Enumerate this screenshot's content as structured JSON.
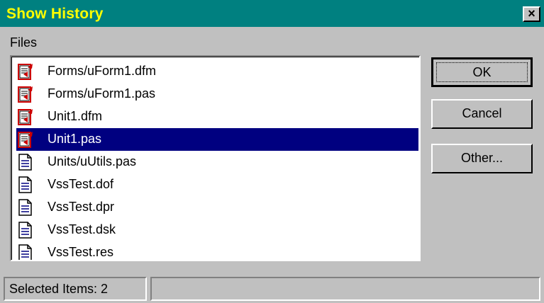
{
  "window": {
    "title": "Show History",
    "close_glyph": "×"
  },
  "files_label": "Files",
  "files": [
    {
      "name": "Forms/uForm1.dfm",
      "icon": "checked-out-file-icon",
      "selected": false
    },
    {
      "name": "Forms/uForm1.pas",
      "icon": "checked-out-file-icon",
      "selected": false
    },
    {
      "name": "Unit1.dfm",
      "icon": "checked-out-file-icon",
      "selected": false
    },
    {
      "name": "Unit1.pas",
      "icon": "checked-out-file-icon",
      "selected": true
    },
    {
      "name": "Units/uUtils.pas",
      "icon": "document-icon",
      "selected": false
    },
    {
      "name": "VssTest.dof",
      "icon": "document-icon",
      "selected": false
    },
    {
      "name": "VssTest.dpr",
      "icon": "document-icon",
      "selected": false
    },
    {
      "name": "VssTest.dsk",
      "icon": "document-icon",
      "selected": false
    },
    {
      "name": "VssTest.res",
      "icon": "document-icon",
      "selected": false
    }
  ],
  "buttons": {
    "ok": "OK",
    "cancel": "Cancel",
    "other": "Other..."
  },
  "status": {
    "selected_items": "Selected Items: 2",
    "second_pane": ""
  },
  "colors": {
    "title_bg": "#008080",
    "title_text": "#ffff00",
    "selection": "#000080",
    "face": "#c0c0c0",
    "checkout_red": "#cc0000"
  }
}
